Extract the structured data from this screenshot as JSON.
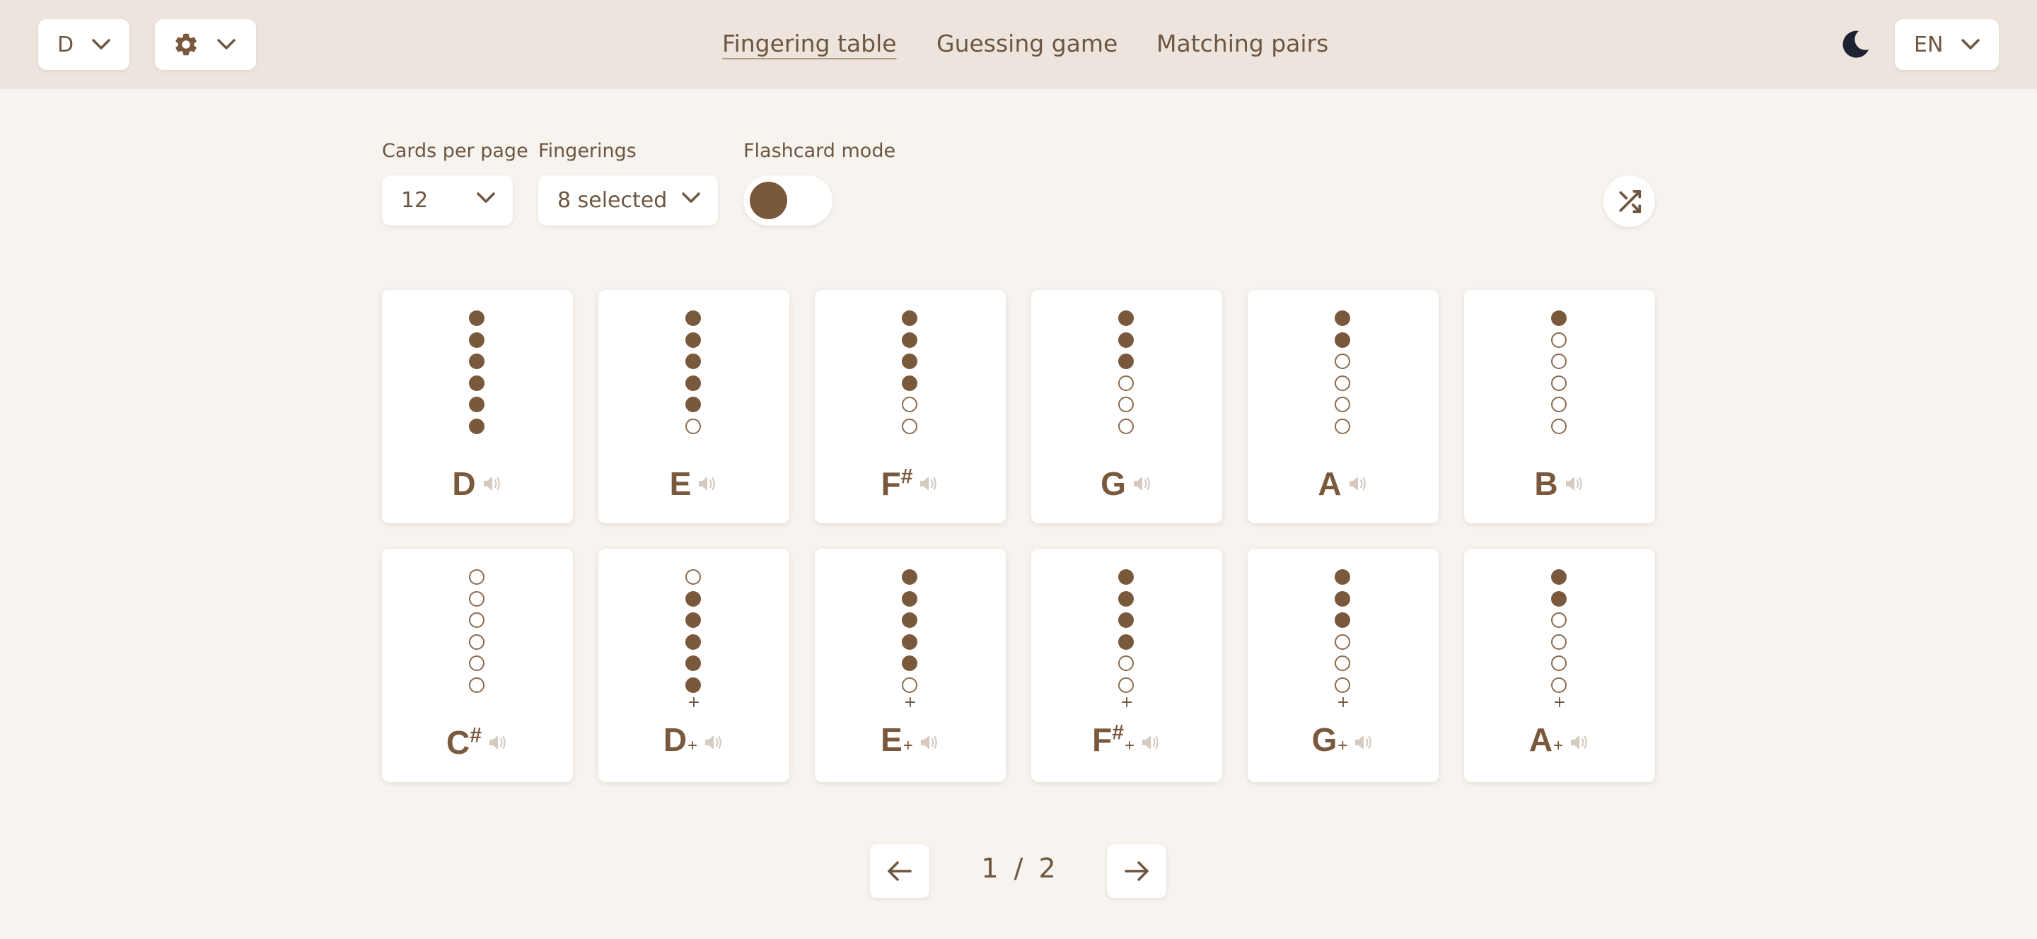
{
  "header": {
    "key_select": "D",
    "language_select": "EN",
    "nav": [
      {
        "label": "Fingering table",
        "active": true
      },
      {
        "label": "Guessing game",
        "active": false
      },
      {
        "label": "Matching pairs",
        "active": false
      }
    ],
    "icons": {
      "settings": "gear-icon",
      "theme": "moon-icon"
    }
  },
  "controls": {
    "cards_per_page": {
      "label": "Cards per page",
      "value": "12"
    },
    "fingerings": {
      "label": "Fingerings",
      "value": "8 selected"
    },
    "flashcard_mode": {
      "label": "Flashcard mode",
      "enabled": false
    },
    "shuffle_icon": "shuffle-icon"
  },
  "cards": [
    {
      "note": "D",
      "sharp": false,
      "plus": false,
      "holes": [
        1,
        1,
        1,
        1,
        1,
        1
      ]
    },
    {
      "note": "E",
      "sharp": false,
      "plus": false,
      "holes": [
        1,
        1,
        1,
        1,
        1,
        0
      ]
    },
    {
      "note": "F",
      "sharp": true,
      "plus": false,
      "holes": [
        1,
        1,
        1,
        1,
        0,
        0
      ]
    },
    {
      "note": "G",
      "sharp": false,
      "plus": false,
      "holes": [
        1,
        1,
        1,
        0,
        0,
        0
      ]
    },
    {
      "note": "A",
      "sharp": false,
      "plus": false,
      "holes": [
        1,
        1,
        0,
        0,
        0,
        0
      ]
    },
    {
      "note": "B",
      "sharp": false,
      "plus": false,
      "holes": [
        1,
        0,
        0,
        0,
        0,
        0
      ]
    },
    {
      "note": "C",
      "sharp": true,
      "plus": false,
      "holes": [
        0,
        0,
        0,
        0,
        0,
        0
      ]
    },
    {
      "note": "D",
      "sharp": false,
      "plus": true,
      "holes": [
        0,
        1,
        1,
        1,
        1,
        1
      ]
    },
    {
      "note": "E",
      "sharp": false,
      "plus": true,
      "holes": [
        1,
        1,
        1,
        1,
        1,
        0
      ]
    },
    {
      "note": "F",
      "sharp": true,
      "plus": true,
      "holes": [
        1,
        1,
        1,
        1,
        0,
        0
      ]
    },
    {
      "note": "G",
      "sharp": false,
      "plus": true,
      "holes": [
        1,
        1,
        1,
        0,
        0,
        0
      ]
    },
    {
      "note": "A",
      "sharp": false,
      "plus": true,
      "holes": [
        1,
        1,
        0,
        0,
        0,
        0
      ]
    }
  ],
  "symbols": {
    "sharp": "#",
    "plus": "+"
  },
  "pagination": {
    "current": "1",
    "separator": "/",
    "total": "2"
  },
  "colors": {
    "accent": "#7a583c",
    "text": "#6e5640",
    "header_bg": "#ede5dd",
    "page_bg": "#f7f3ef",
    "moon": "#1d2333"
  }
}
